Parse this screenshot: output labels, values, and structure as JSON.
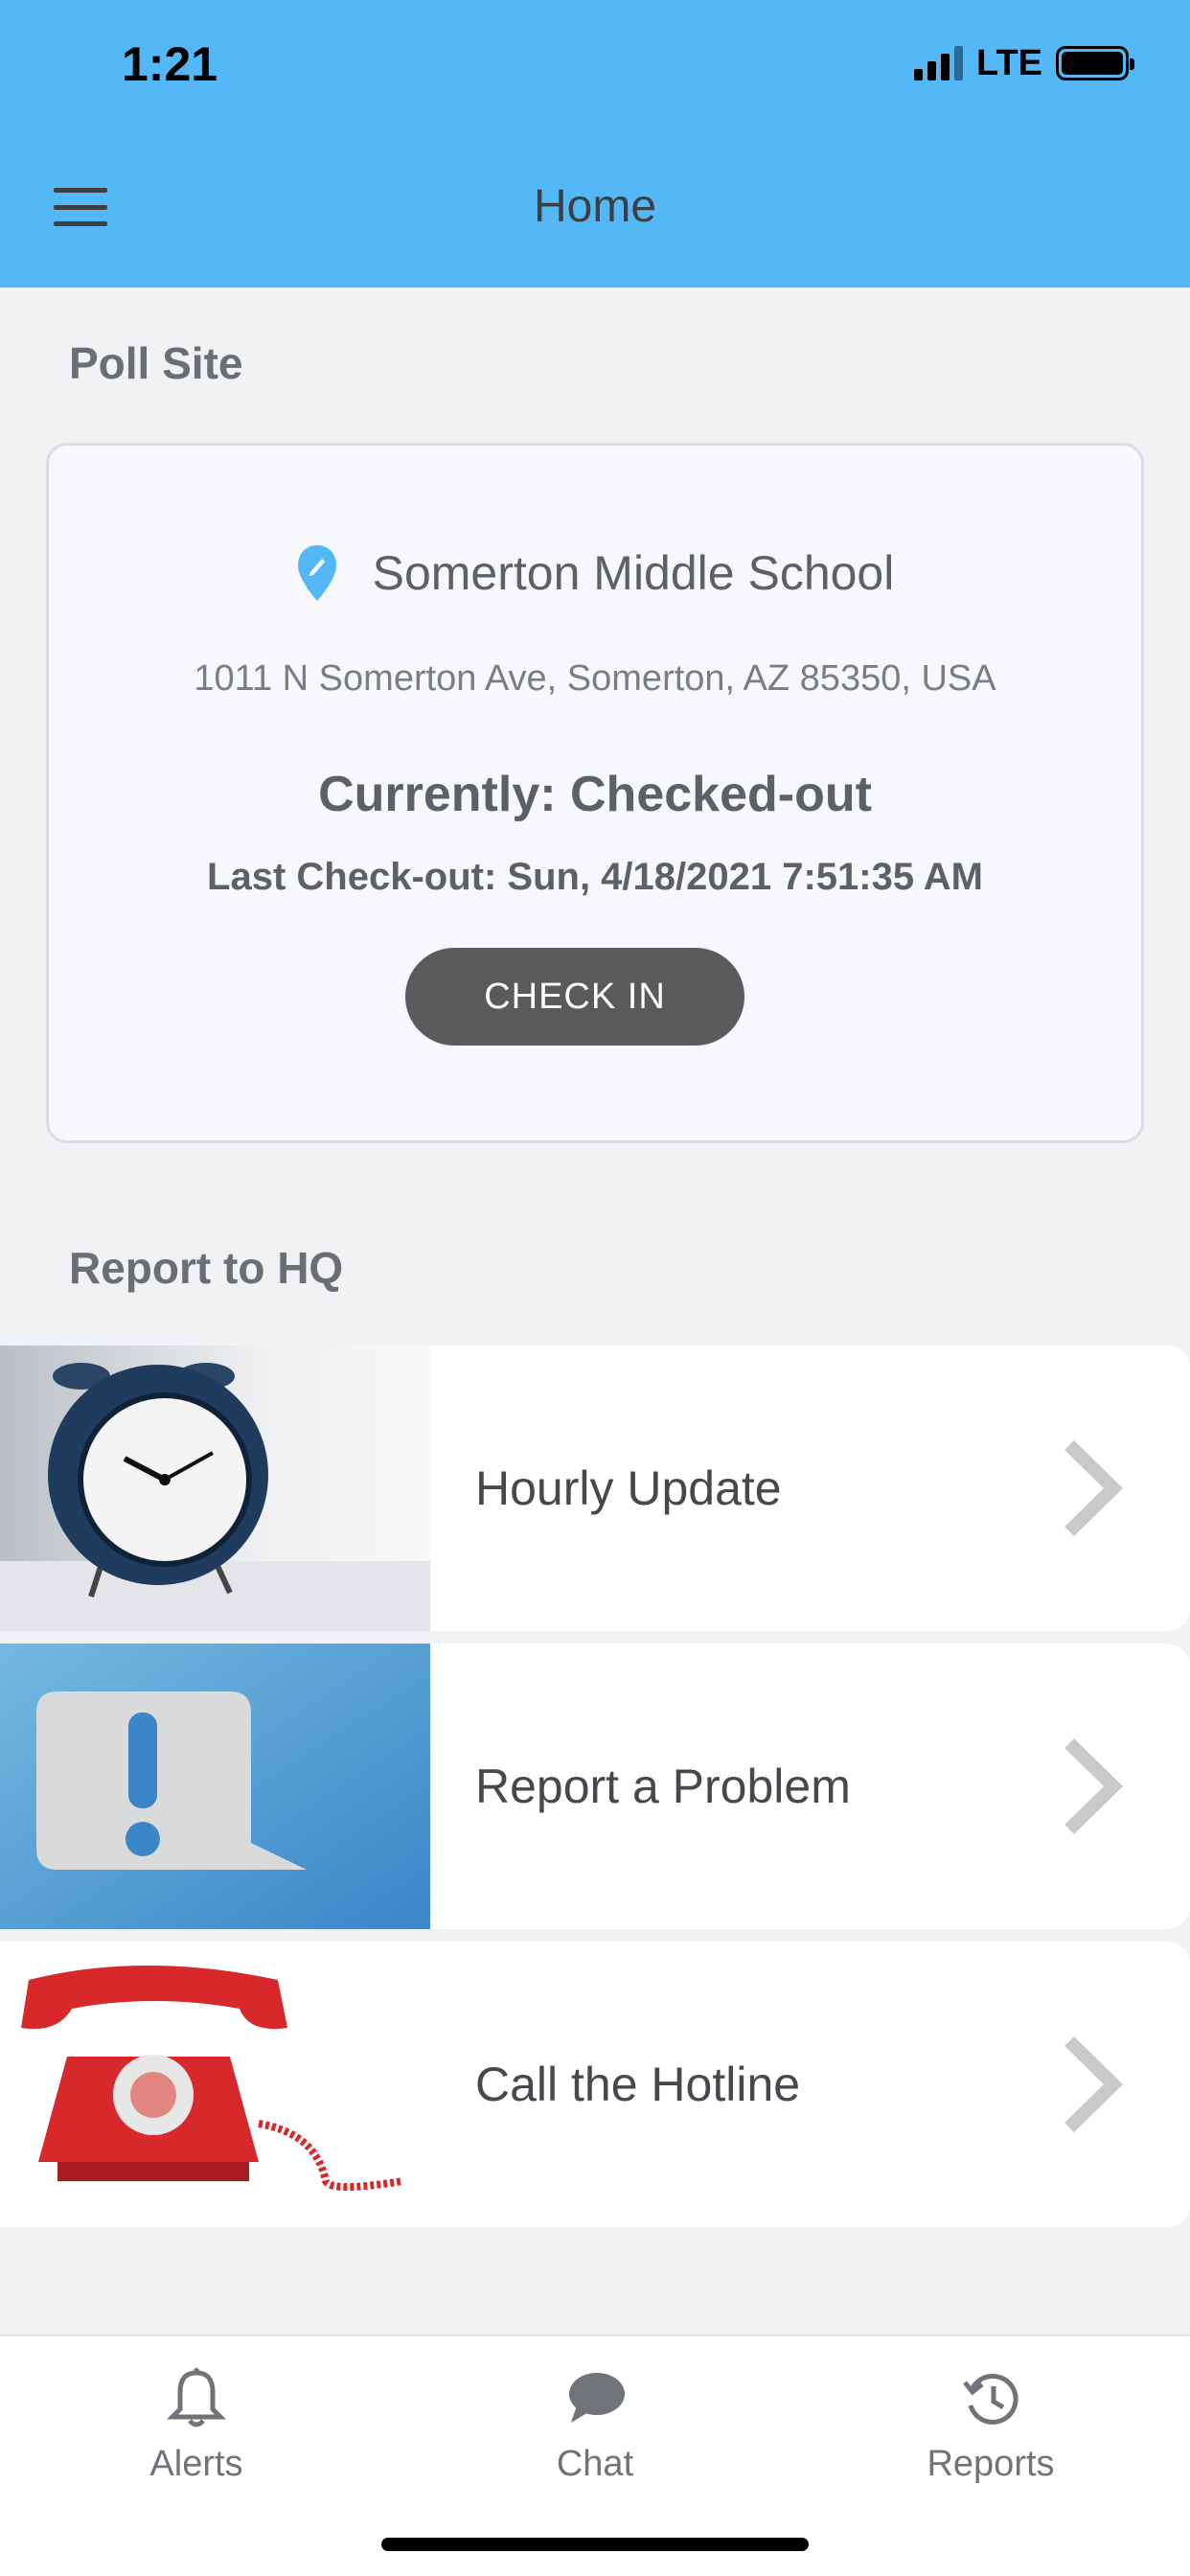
{
  "status_bar": {
    "time": "1:21",
    "network": "LTE"
  },
  "header": {
    "title": "Home",
    "menu_icon": "hamburger-icon"
  },
  "poll_site": {
    "heading": "Poll Site",
    "pin_icon": "map-pin-icon",
    "name": "Somerton Middle School",
    "address": "1011 N Somerton Ave, Somerton, AZ 85350, USA",
    "status": "Currently: Checked-out",
    "last_checkout": "Last Check-out: Sun, 4/18/2021 7:51:35 AM",
    "button_label": "CHECK IN",
    "pin_color": "#54b8f7",
    "button_color": "#595a5c"
  },
  "report": {
    "heading": "Report to HQ",
    "items": [
      {
        "label": "Hourly Update",
        "image": "alarm-clock-image",
        "icon": "chevron-right-icon"
      },
      {
        "label": "Report a Problem",
        "image": "exclamation-bubble-image",
        "icon": "chevron-right-icon"
      },
      {
        "label": "Call the Hotline",
        "image": "red-telephone-image",
        "icon": "chevron-right-icon"
      }
    ]
  },
  "tabs": [
    {
      "label": "Alerts",
      "icon": "bell-icon"
    },
    {
      "label": "Chat",
      "icon": "chat-bubble-icon"
    },
    {
      "label": "Reports",
      "icon": "history-icon"
    }
  ],
  "colors": {
    "header_bg": "#54b8f7",
    "page_bg": "#f1f2f4"
  }
}
